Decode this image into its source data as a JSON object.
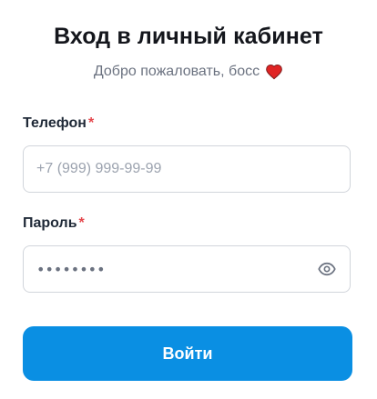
{
  "header": {
    "title": "Вход в личный кабинет",
    "subtitle": "Добро пожаловать, босс",
    "subtitle_icon": "heart-icon"
  },
  "form": {
    "phone": {
      "label": "Телефон",
      "required_mark": "*",
      "value": "",
      "placeholder": "+7 (999) 999-99-99"
    },
    "password": {
      "label": "Пароль",
      "required_mark": "*",
      "masked_value": "••••••••",
      "toggle_icon": "eye-icon"
    },
    "submit_label": "Войти"
  },
  "colors": {
    "accent": "#0a8fe3",
    "required": "#e5484d",
    "heart": "#e02424",
    "border": "#d1d5db"
  }
}
